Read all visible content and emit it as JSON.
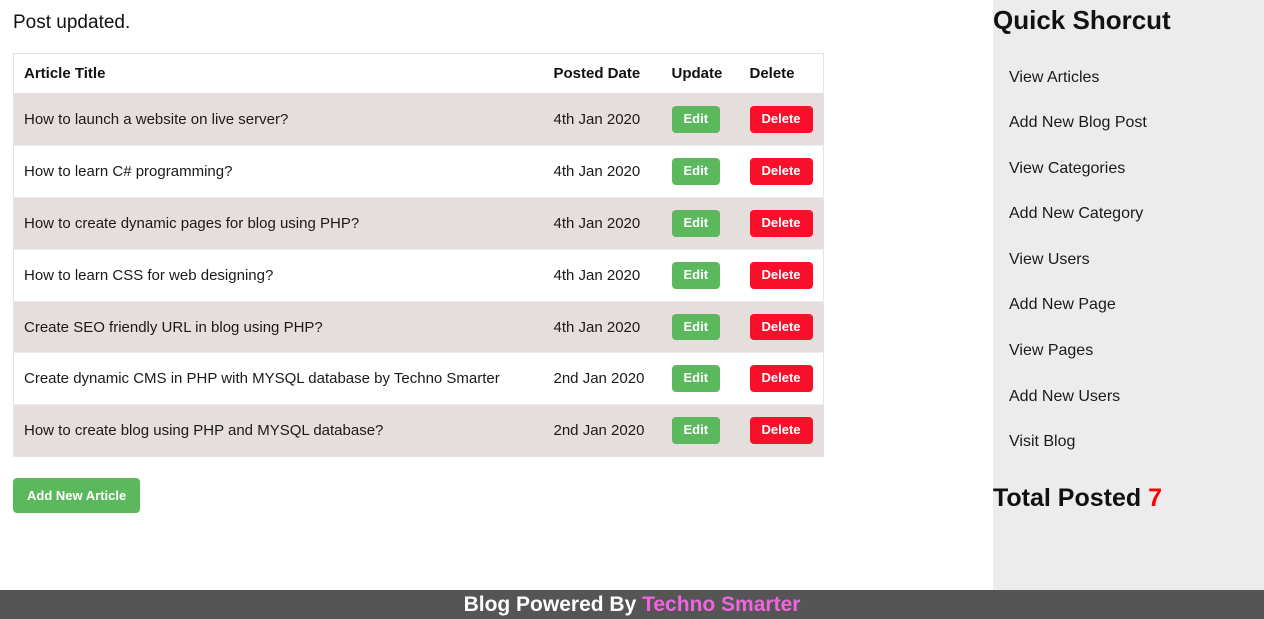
{
  "flash": {
    "message": "Post updated."
  },
  "table": {
    "columns": [
      "Article Title",
      "Posted Date",
      "Update",
      "Delete"
    ],
    "rows": [
      {
        "title": "How to launch a website on live server?",
        "date": "4th Jan 2020",
        "edit_label": "Edit",
        "delete_label": "Delete"
      },
      {
        "title": "How to learn C# programming?",
        "date": "4th Jan 2020",
        "edit_label": "Edit",
        "delete_label": "Delete"
      },
      {
        "title": "How to create dynamic pages for blog using PHP?",
        "date": "4th Jan 2020",
        "edit_label": "Edit",
        "delete_label": "Delete"
      },
      {
        "title": "How to learn CSS for web designing?",
        "date": "4th Jan 2020",
        "edit_label": "Edit",
        "delete_label": "Delete"
      },
      {
        "title": "Create SEO friendly URL in blog using PHP?",
        "date": "4th Jan 2020",
        "edit_label": "Edit",
        "delete_label": "Delete"
      },
      {
        "title": "Create dynamic CMS in PHP with MYSQL database by Techno Smarter",
        "date": "2nd Jan 2020",
        "edit_label": "Edit",
        "delete_label": "Delete"
      },
      {
        "title": "How to create blog using PHP and MYSQL database?",
        "date": "2nd Jan 2020",
        "edit_label": "Edit",
        "delete_label": "Delete"
      }
    ]
  },
  "actions": {
    "add_article_label": "Add New Article"
  },
  "sidebar": {
    "title": "Quick Shorcut",
    "items": [
      {
        "label": "View Articles"
      },
      {
        "label": "Add New Blog Post"
      },
      {
        "label": "View Categories"
      },
      {
        "label": "Add New Category"
      },
      {
        "label": "View Users"
      },
      {
        "label": "Add New Page"
      },
      {
        "label": "View Pages"
      },
      {
        "label": "Add New Users"
      },
      {
        "label": "Visit Blog"
      }
    ],
    "total_posted_label": "Total Posted",
    "total_posted_count": "7"
  },
  "footer": {
    "text": "Blog Powered By",
    "brand": "Techno Smarter"
  },
  "colors": {
    "edit_green": "#5cb85c",
    "delete_red": "#f80f2a",
    "stripe_row": "#e6dedc",
    "sidebar_bg": "#ececec",
    "footer_bg": "#555555",
    "footer_brand": "#ee66dd",
    "count_red": "#ff0000"
  }
}
